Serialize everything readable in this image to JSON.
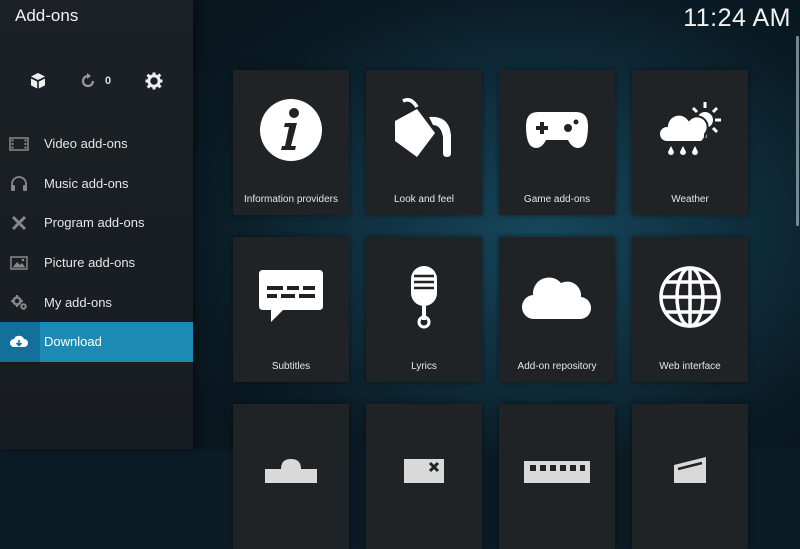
{
  "header": {
    "title": "Add-ons",
    "time": "11:24 AM"
  },
  "toolbar": {
    "update_count": "0"
  },
  "sidebar": {
    "items": [
      {
        "label": "Video add-ons",
        "icon": "film-icon"
      },
      {
        "label": "Music add-ons",
        "icon": "headphones-icon"
      },
      {
        "label": "Program add-ons",
        "icon": "tools-icon"
      },
      {
        "label": "Picture add-ons",
        "icon": "picture-icon"
      },
      {
        "label": "My add-ons",
        "icon": "gears-icon"
      },
      {
        "label": "Download",
        "icon": "cloud-download-icon",
        "active": true
      }
    ]
  },
  "tiles": [
    {
      "label": "Information providers",
      "icon": "info-icon"
    },
    {
      "label": "Look and feel",
      "icon": "paint-bucket-icon"
    },
    {
      "label": "Game add-ons",
      "icon": "gamepad-icon"
    },
    {
      "label": "Weather",
      "icon": "weather-icon"
    },
    {
      "label": "Subtitles",
      "icon": "subtitles-icon"
    },
    {
      "label": "Lyrics",
      "icon": "microphone-icon"
    },
    {
      "label": "Add-on repository",
      "icon": "cloud-icon"
    },
    {
      "label": "Web interface",
      "icon": "globe-icon"
    }
  ],
  "colors": {
    "accent": "#1b8bb5",
    "sidebar": "#1b2126",
    "tile": "#1f2326"
  }
}
